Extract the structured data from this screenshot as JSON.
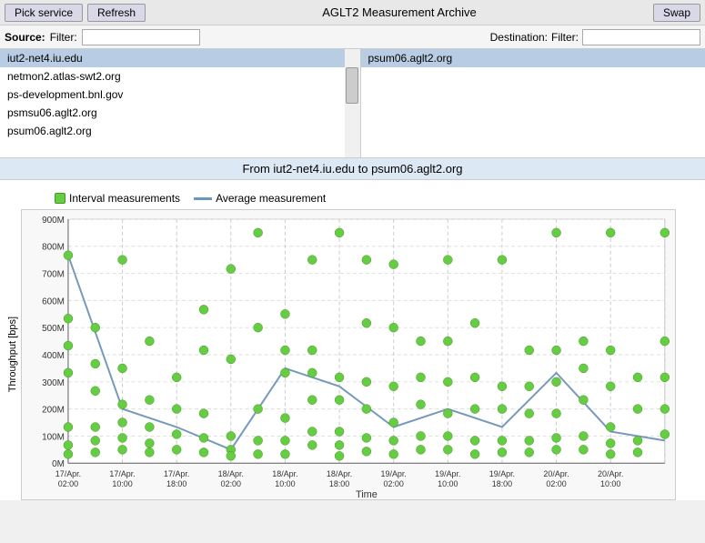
{
  "topbar": {
    "pick_service_label": "Pick service",
    "refresh_label": "Refresh",
    "title": "AGLT2 Measurement Archive",
    "swap_label": "Swap"
  },
  "filter_bar": {
    "source_label": "Source:",
    "filter_label": "Filter:",
    "destination_label": "Destination:",
    "filter_label2": "Filter:",
    "source_filter_placeholder": "",
    "dest_filter_placeholder": ""
  },
  "source_list": [
    {
      "label": "iut2-net4.iu.edu",
      "selected": true
    },
    {
      "label": "netmon2.atlas-swt2.org",
      "selected": false
    },
    {
      "label": "ps-development.bnl.gov",
      "selected": false
    },
    {
      "label": "psmsu06.aglt2.org",
      "selected": false
    },
    {
      "label": "psum06.aglt2.org",
      "selected": false
    }
  ],
  "dest_list": [
    {
      "label": "psum06.aglt2.org",
      "selected": true
    }
  ],
  "from_to": "From iut2-net4.iu.edu to psum06.aglt2.org",
  "legend": {
    "interval_label": "Interval measurements",
    "average_label": "Average measurement"
  },
  "chart": {
    "y_axis_label": "Throughput [bps]",
    "x_axis_label": "Time",
    "y_ticks": [
      "0M",
      "100M",
      "200M",
      "300M",
      "400M",
      "500M",
      "600M",
      "700M",
      "800M",
      "900M"
    ],
    "x_ticks": [
      "17/Apr.\n02:00",
      "17/Apr.\n10:00",
      "17/Apr.\n18:00",
      "18/Apr.\n02:00",
      "18/Apr.\n10:00",
      "18/Apr.\n18:00",
      "19/Apr.\n02:00",
      "19/Apr.\n10:00",
      "19/Apr.\n18:00",
      "20/Apr.\n02:00",
      "20/Apr.\n10:00"
    ]
  }
}
